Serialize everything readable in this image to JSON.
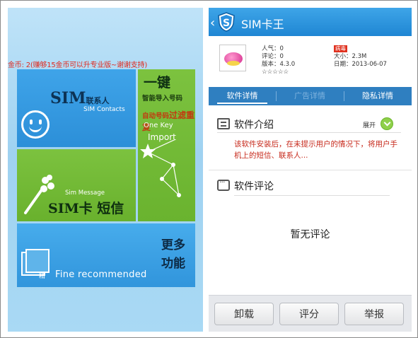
{
  "left_screen": {
    "coins_text": "金币: 2(赚够15金币可以升专业版~谢谢支持)",
    "tiles": {
      "contacts": {
        "title": "SIM",
        "title_suffix": "联系人",
        "subtitle": "SIM Contacts"
      },
      "import": {
        "title": "一键",
        "line1": "智能导入号码",
        "line2_prefix": "自动号码",
        "line2_emph": "过滤重复",
        "en1": "One Key",
        "en2": "Import"
      },
      "message": {
        "subtitle": "Sim Message",
        "title": "SIM卡 短信"
      },
      "fine": {
        "label": "Fine  recommended",
        "icon_glyph": "精",
        "more": "更多功能"
      }
    }
  },
  "right_screen": {
    "header": {
      "title": "SIM卡王"
    },
    "app_info": {
      "popularity": "人气：0",
      "reviews": "评论：0",
      "version": "版本：4.3.0",
      "rating": "☆☆☆☆☆",
      "badge": "病毒",
      "size": "大小：2.3M",
      "date": "日期：2013-06-07"
    },
    "tabs": [
      {
        "label": "软件详情",
        "active": true
      },
      {
        "label": "广告详情",
        "active": false
      },
      {
        "label": "隐私详情",
        "active": false
      }
    ],
    "intro": {
      "title": "软件介绍",
      "expand_label": "展开",
      "description": "该软件安装后，在未提示用户的情况下，将用户手机上的短信、联系人..."
    },
    "comments": {
      "title": "软件评论",
      "empty_text": "暂无评论"
    },
    "buttons": {
      "uninstall": "卸载",
      "rate": "评分",
      "report": "举报"
    }
  },
  "colors": {
    "blue_tile": "#3195dc",
    "green_tile": "#6ab32f",
    "accent_red": "#c72a1c",
    "header_blue": "#1f86d3"
  }
}
